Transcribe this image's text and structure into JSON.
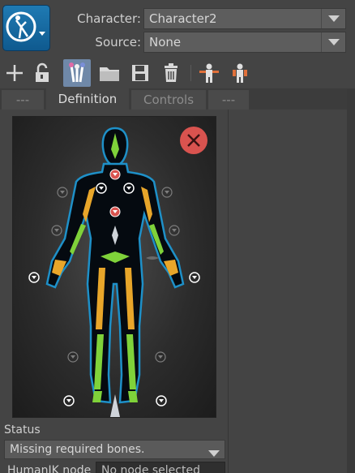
{
  "header": {
    "character_label": "Character:",
    "character_value": "Character2",
    "source_label": "Source:",
    "source_value": "None"
  },
  "toolbar": {
    "icons": [
      "add-icon",
      "unlock-icon",
      "define-skeleton-icon",
      "open-folder-icon",
      "save-icon",
      "delete-icon",
      "t-pose-icon",
      "character-pose-icon"
    ]
  },
  "tabs": [
    {
      "label": "---",
      "active": false
    },
    {
      "label": "Definition",
      "active": true
    },
    {
      "label": "Controls",
      "active": false
    },
    {
      "label": "---",
      "active": false
    }
  ],
  "colors": {
    "bone_required_missing": "#e8a62a",
    "bone_defined": "#7fd23a",
    "error_red": "#d9534f",
    "figure_outline": "#1e90c8"
  },
  "status": {
    "label": "Status",
    "value": "Missing required bones."
  },
  "humanik": {
    "label": "HumanIK node",
    "value": "No node selected"
  }
}
